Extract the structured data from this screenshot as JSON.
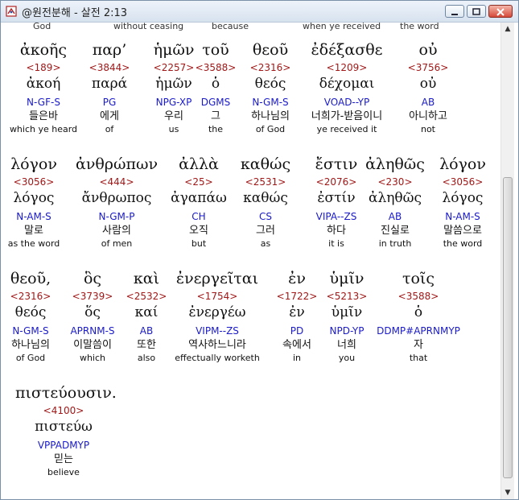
{
  "window": {
    "title": "@원전분해 - 살전 2:13",
    "icon": "bible-book-icon",
    "buttons": [
      "minimize-icon",
      "maximize-icon",
      "close-icon"
    ]
  },
  "cut_row": [
    "God",
    "without ceasing",
    "because",
    "when ye received",
    "the word"
  ],
  "rows": [
    {
      "words": [
        {
          "greek": "ἀκοῆς",
          "num": "<189>",
          "lemma": "ἀκοή",
          "parse": "N-GF-S",
          "korean": "들은바",
          "english": "which ye heard"
        },
        {
          "greek": "παρ’",
          "num": "<3844>",
          "lemma": "παρά",
          "parse": "PG",
          "korean": "에게",
          "english": "of"
        },
        {
          "greek": "ἡμῶν",
          "num": "<2257>",
          "lemma": "ἡμῶν",
          "parse": "NPG-XP",
          "korean": "우리",
          "english": "us"
        },
        {
          "greek": "τοῦ",
          "num": "<3588>",
          "lemma": "ὁ",
          "parse": "DGMS",
          "korean": "그",
          "english": "the"
        },
        {
          "greek": "θεοῦ",
          "num": "<2316>",
          "lemma": "θεός",
          "parse": "N-GM-S",
          "korean": "하나님의",
          "english": "of God"
        },
        {
          "greek": "ἐδέξασθε",
          "num": "<1209>",
          "lemma": "δέχομαι",
          "parse": "VOAD--YP",
          "korean": "너희가-받음이니",
          "english": "ye received it"
        },
        {
          "greek": "οὐ",
          "num": "<3756>",
          "lemma": "οὐ",
          "parse": "AB",
          "korean": "아니하고",
          "english": "not"
        }
      ]
    },
    {
      "words": [
        {
          "greek": "λόγον",
          "num": "<3056>",
          "lemma": "λόγος",
          "parse": "N-AM-S",
          "korean": "말로",
          "english": "as the word"
        },
        {
          "greek": "ἀνθρώπων",
          "num": "<444>",
          "lemma": "ἄνθρωπος",
          "parse": "N-GM-P",
          "korean": "사람의",
          "english": "of men"
        },
        {
          "greek": "ἀλλὰ",
          "num": "<25>",
          "lemma": "ἀγαπάω",
          "parse": "CH",
          "korean": "오직",
          "english": "but"
        },
        {
          "greek": "καθώς",
          "num": "<2531>",
          "lemma": "καθώς",
          "parse": "CS",
          "korean": "그러",
          "english": "as"
        },
        {
          "greek": "ἔστιν",
          "num": "<2076>",
          "lemma": "ἐστίν",
          "parse": "VIPA--ZS",
          "korean": "하다",
          "english": "it is"
        },
        {
          "greek": "ἀληθῶς",
          "num": "<230>",
          "lemma": "ἀληθῶς",
          "parse": "AB",
          "korean": "진실로",
          "english": "in truth"
        },
        {
          "greek": "λόγον",
          "num": "<3056>",
          "lemma": "λόγος",
          "parse": "N-AM-S",
          "korean": "말씀으로",
          "english": "the word"
        }
      ]
    },
    {
      "words": [
        {
          "greek": "θεοῦ,",
          "num": "<2316>",
          "lemma": "θεός",
          "parse": "N-GM-S",
          "korean": "하나님의",
          "english": "of God"
        },
        {
          "greek": "ὃς",
          "num": "<3739>",
          "lemma": "ὅς",
          "parse": "APRNM-S",
          "korean": "이말씀이",
          "english": "which"
        },
        {
          "greek": "καὶ",
          "num": "<2532>",
          "lemma": "καί",
          "parse": "AB",
          "korean": "또한",
          "english": "also"
        },
        {
          "greek": "ἐνεργεῖται",
          "num": "<1754>",
          "lemma": "ἐνεργέω",
          "parse": "VIPM--ZS",
          "korean": "역사하느니라",
          "english": "effectually worketh"
        },
        {
          "greek": "ἐν",
          "num": "<1722>",
          "lemma": "ἐν",
          "parse": "PD",
          "korean": "속에서",
          "english": "in"
        },
        {
          "greek": "ὑμῖν",
          "num": "<5213>",
          "lemma": "ὑμῖν",
          "parse": "NPD-YP",
          "korean": "너희",
          "english": "you"
        },
        {
          "greek": "τοῖς",
          "num": "<3588>",
          "lemma": "ὁ",
          "parse": "DDMP#APRNMYP",
          "korean": "자",
          "english": "that"
        }
      ]
    },
    {
      "words": [
        {
          "greek": "πιστεύουσιν.",
          "num": "<4100>",
          "lemma": "πιστεύω",
          "parse": "VPPADMYP",
          "korean": "믿는",
          "english": "believe"
        }
      ]
    }
  ]
}
